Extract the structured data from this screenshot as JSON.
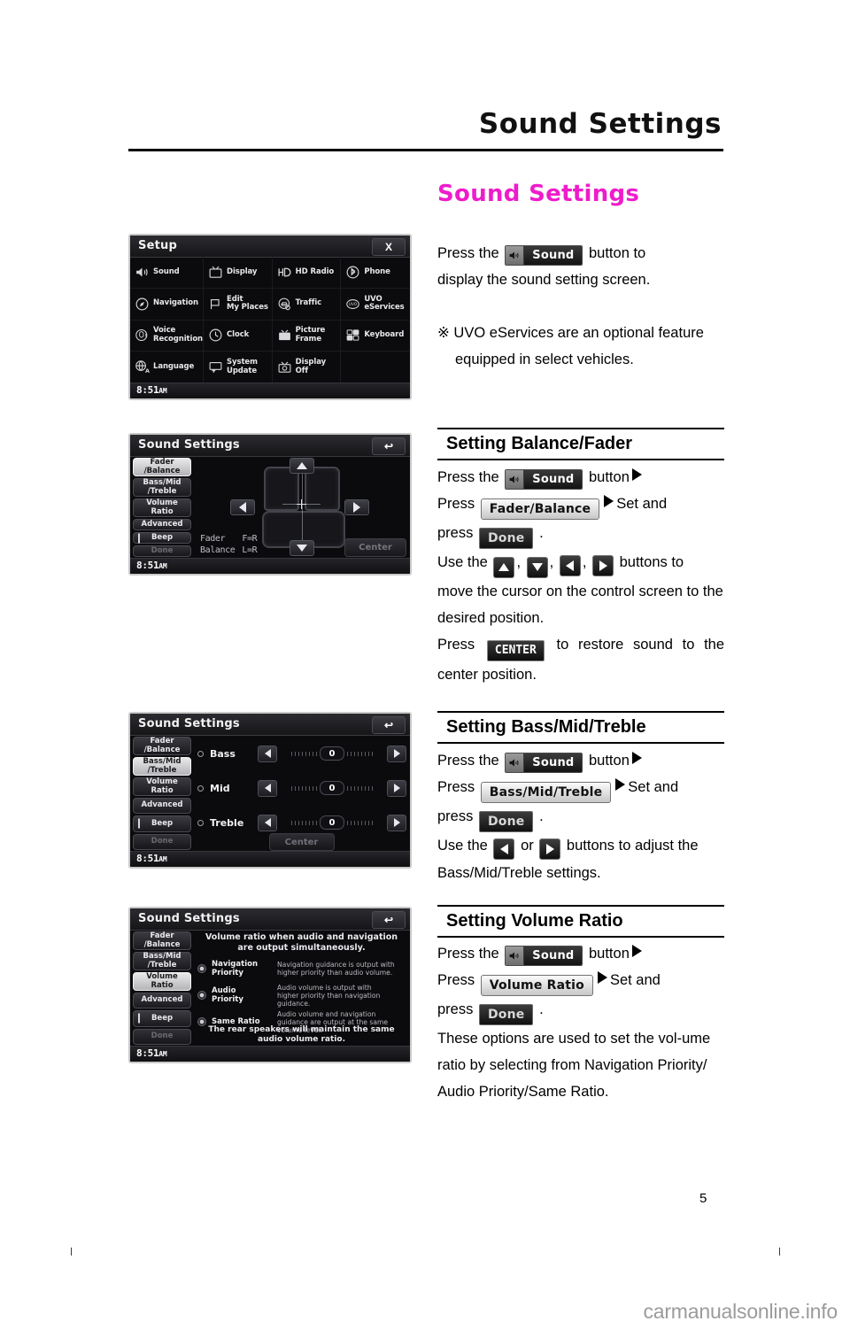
{
  "header": {
    "title": "Sound Settings"
  },
  "doc_title": "Sound Settings",
  "page_number": "5",
  "watermark": "carmanualsonline.info",
  "colors": {
    "accent_pink": "#ee1ccb",
    "rule_black": "#000000",
    "screen_background": "#0b0b0d"
  },
  "intro": {
    "line1_pre": "Press the",
    "sound_badge": "Sound",
    "line1_post": "button to",
    "line2": "display the sound setting screen.",
    "note_mark": "※",
    "note": "UVO eServices are an optional feature equipped in select vehicles."
  },
  "sections": [
    {
      "heading": "Setting Balance/Fader",
      "press_the": "Press the",
      "sound_badge": "Sound",
      "button_word": "button",
      "press_word": "Press",
      "menu_badge": "Fader/Balance",
      "set_and": "Set and",
      "press_word2": "press",
      "done_badge": "Done",
      "period": ".",
      "use_the": "Use the",
      "comma": ",",
      "buttons_to": "buttons to",
      "body": "move the cursor on the control screen to the desired position.",
      "press_word3": "Press",
      "center_badge": "CENTER",
      "body2": "to restore sound to the center position."
    },
    {
      "heading": "Setting Bass/Mid/Treble",
      "press_the": "Press the",
      "sound_badge": "Sound",
      "button_word": "button",
      "press_word": "Press",
      "menu_badge": "Bass/Mid/Treble",
      "set_and": "Set and",
      "press_word2": "press",
      "done_badge": "Done",
      "period": ".",
      "use_the": "Use the",
      "or_word": "or",
      "buttons_to_adjust": "buttons to adjust the",
      "body": "Bass/Mid/Treble settings."
    },
    {
      "heading": "Setting Volume Ratio",
      "press_the": "Press the",
      "sound_badge": "Sound",
      "button_word": "button",
      "press_word": "Press",
      "menu_badge": "Volume Ratio",
      "set_and": "Set and",
      "press_word2": "press",
      "done_badge": "Done",
      "period": ".",
      "body": "These options are used to set the vol-ume ratio by selecting from Navigation Priority/ Audio Priority/Same Ratio."
    }
  ],
  "screens": {
    "setup": {
      "title": "Setup",
      "close_label": "X",
      "clock": "8:51",
      "clock_ampm": "AM",
      "items": [
        {
          "label": "Sound",
          "icon": "speaker-icon"
        },
        {
          "label": "Display",
          "icon": "monitor-icon"
        },
        {
          "label": "HD Radio",
          "icon": "hd-radio-icon"
        },
        {
          "label": "Phone",
          "icon": "bluetooth-icon"
        },
        {
          "label": "Navigation",
          "icon": "compass-icon"
        },
        {
          "label": "Edit\nMy Places",
          "icon": "flag-icon"
        },
        {
          "label": "Traffic",
          "icon": "traffic-car-icon"
        },
        {
          "label": "UVO\neServices",
          "icon": "uvo-icon"
        },
        {
          "label": "Voice\nRecognition",
          "icon": "voice-recognition-icon"
        },
        {
          "label": "Clock",
          "icon": "clock-icon"
        },
        {
          "label": "Picture\nFrame",
          "icon": "picture-frame-icon"
        },
        {
          "label": "Keyboard",
          "icon": "keyboard-icon"
        },
        {
          "label": "Language",
          "icon": "globe-a-icon"
        },
        {
          "label": "System\nUpdate",
          "icon": "system-update-icon"
        },
        {
          "label": "Display Off",
          "icon": "display-off-icon"
        }
      ]
    },
    "sound_settings_nav": [
      "Fader\n/Balance",
      "Bass/Mid\n/Treble",
      "Volume\nRatio",
      "Advanced",
      "Beep",
      "Done"
    ],
    "fader_balance": {
      "title": "Sound Settings",
      "back_label": "↩",
      "active_nav": "Fader\n/Balance",
      "readout": [
        {
          "label": "Fader",
          "value": "F=R"
        },
        {
          "label": "Balance",
          "value": "L=R"
        }
      ],
      "center_button": "Center",
      "clock": "8:51",
      "clock_ampm": "AM"
    },
    "bass_mid_treble": {
      "title": "Sound Settings",
      "back_label": "↩",
      "active_nav": "Bass/Mid\n/Treble",
      "rows": [
        {
          "name": "Bass",
          "value": "0"
        },
        {
          "name": "Mid",
          "value": "0"
        },
        {
          "name": "Treble",
          "value": "0"
        }
      ],
      "center_button": "Center",
      "clock": "8:51",
      "clock_ampm": "AM"
    },
    "volume_ratio": {
      "title": "Sound Settings",
      "back_label": "↩",
      "active_nav": "Volume\nRatio",
      "header_text": "Volume ratio when audio and navigation are output simultaneously.",
      "options": [
        {
          "name": "Navigation\nPriority",
          "desc": "Navigation guidance is output with\nhigher priority than audio volume."
        },
        {
          "name": "Audio\nPriority",
          "desc": "Audio volume is output with\nhigher priority than navigation guidance."
        },
        {
          "name": "Same Ratio",
          "desc": "Audio volume and navigation\nguidance are output at the same\nvolume level."
        }
      ],
      "footer_text": "The rear speakers will maintain the same\naudio volume ratio.",
      "clock": "8:51",
      "clock_ampm": "AM"
    }
  }
}
